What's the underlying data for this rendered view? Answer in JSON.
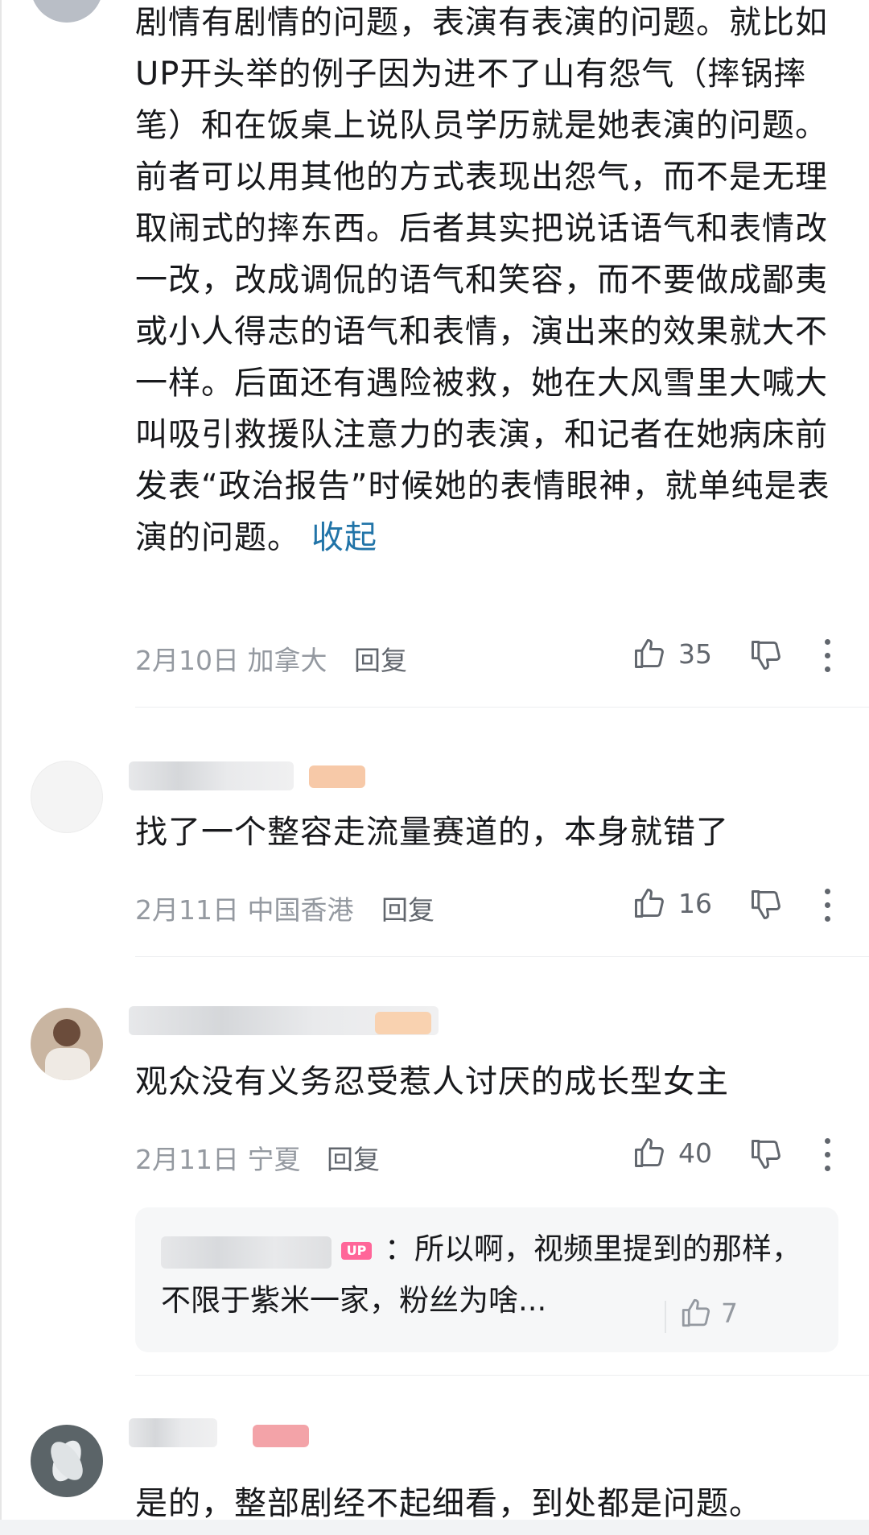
{
  "comments": [
    {
      "text": "剧情有剧情的问题，表演有表演的问题。就比如UP开头举的例子因为进不了山有怨气（摔锅摔笔）和在饭桌上说队员学历就是她表演的问题。前者可以用其他的方式表现出怨气，而不是无理取闹式的摔东西。后者其实把说话语气和表情改一改，改成调侃的语气和笑容，而不要做成鄙夷或小人得志的语气和表情，演出来的效果就大不一样。后面还有遇险被救，她在大风雪里大喊大叫吸引救援队注意力的表演，和记者在她病床前发表“政治报告”时候她的表情眼神，就单纯是表演的问题。",
      "collapse_label": "收起",
      "date_location": "2月10日 加拿大",
      "reply_label": "回复",
      "likes": "35"
    },
    {
      "text": "找了一个整容走流量赛道的，本身就错了",
      "date_location": "2月11日 中国香港",
      "reply_label": "回复",
      "likes": "16"
    },
    {
      "text": "观众没有义务忍受惹人讨厌的成长型女主",
      "date_location": "2月11日 宁夏",
      "reply_label": "回复",
      "likes": "40",
      "sub_reply": {
        "badge": "UP",
        "text": "：所以啊，视频里提到的那样，不限于紫米一家，粉丝为啥...",
        "likes": "7"
      }
    },
    {
      "text": "是的，整部剧经不起细看，到处都是问题。"
    }
  ],
  "colors": {
    "text_primary": "#18191c",
    "text_meta": "#9499a0",
    "text_secondary": "#61666d",
    "link": "#2174a8",
    "up_badge": "#ff6699",
    "reply_bg": "#f6f7f8"
  },
  "icons": [
    "thumbs-up-icon",
    "thumbs-down-icon",
    "more-vertical-icon"
  ]
}
